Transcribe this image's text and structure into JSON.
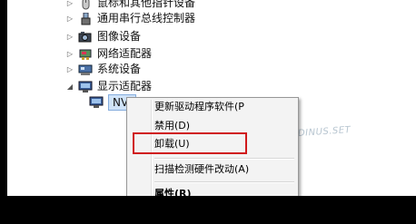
{
  "tree": {
    "items": [
      {
        "label": "鼠标和其他指针设备",
        "arrow": "▷",
        "icon": "mouse-icon"
      },
      {
        "label": "通用串行总线控制器",
        "arrow": "▷",
        "icon": "usb-icon"
      },
      {
        "label": "图像设备",
        "arrow": "▷",
        "icon": "camera-icon"
      },
      {
        "label": "网络适配器",
        "arrow": "▷",
        "icon": "network-adapter-icon"
      },
      {
        "label": "系统设备",
        "arrow": "▷",
        "icon": "system-device-icon"
      },
      {
        "label": "显示适配器",
        "arrow": "◢",
        "icon": "display-adapter-icon"
      }
    ],
    "child": {
      "label": "NVI",
      "icon": "display-card-icon"
    }
  },
  "context_menu": {
    "items": [
      {
        "label": "更新驱动程序软件(P",
        "bold": false
      },
      {
        "label": "禁用(D)",
        "bold": false
      },
      {
        "label": "卸载(U)",
        "bold": false,
        "highlighted": true
      },
      {
        "label": "扫描检测硬件改动(A)",
        "bold": false
      },
      {
        "label": "属性(R)",
        "bold": true
      }
    ]
  },
  "watermark": {
    "text": "LOXEDINUS.SET"
  },
  "colors": {
    "highlight_border": "#d0191b",
    "selection_bg": "#cfe3f8",
    "menu_bg": "#f3f3f3",
    "background": "#000000"
  }
}
